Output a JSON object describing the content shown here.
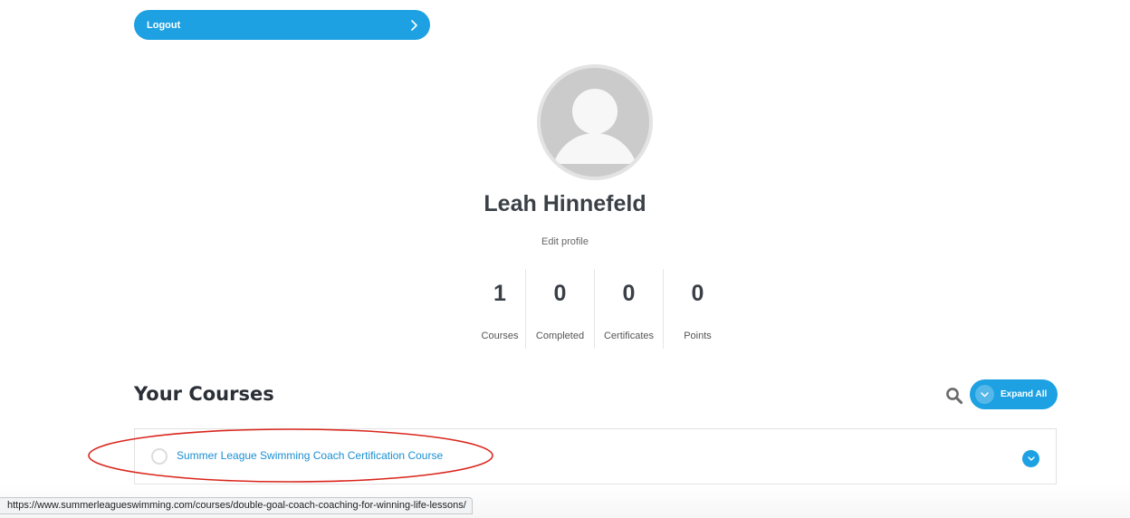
{
  "header": {
    "logout_label": "Logout"
  },
  "profile": {
    "name": "Leah Hinnefeld",
    "edit_label": "Edit profile"
  },
  "stats": [
    {
      "value": "1",
      "label": "Courses"
    },
    {
      "value": "0",
      "label": "Completed"
    },
    {
      "value": "0",
      "label": "Certificates"
    },
    {
      "value": "0",
      "label": "Points"
    }
  ],
  "courses": {
    "heading": "Your Courses",
    "expand_all_label": "Expand All",
    "items": [
      {
        "title": "Summer League Swimming Coach Certification Course"
      }
    ]
  },
  "status_bar": {
    "url": "https://www.summerleagueswimming.com/courses/double-goal-coach-coaching-for-winning-life-lessons/"
  },
  "colors": {
    "accent": "#1da1e2",
    "link": "#1a8fd1",
    "annotation": "#d9261c"
  },
  "icons": {
    "logout": "chevron-right-icon",
    "search": "search-icon",
    "expand": "chevron-down-icon",
    "avatar": "user-avatar-icon"
  }
}
